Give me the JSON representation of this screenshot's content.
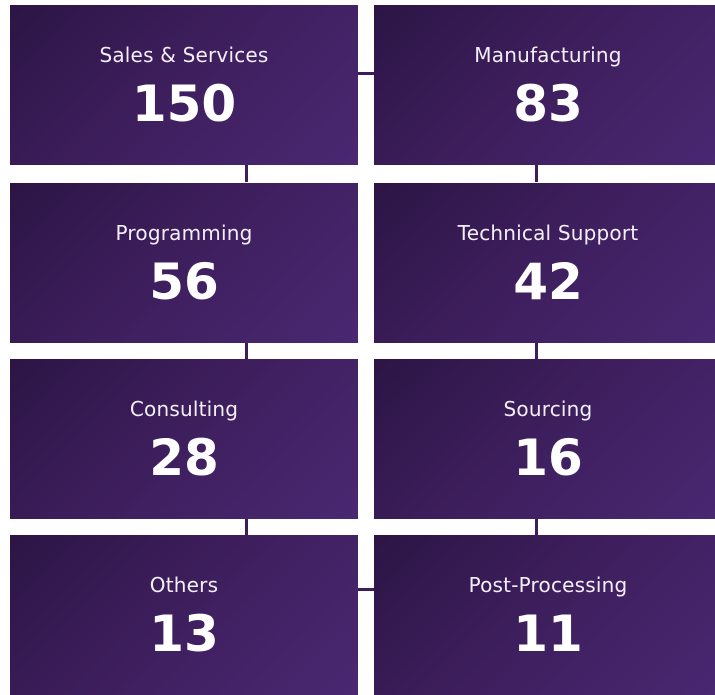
{
  "tiles": [
    {
      "label": "Sales & Services",
      "value": "150"
    },
    {
      "label": "Manufacturing",
      "value": "83"
    },
    {
      "label": "Programming",
      "value": "56"
    },
    {
      "label": "Technical Support",
      "value": "42"
    },
    {
      "label": "Consulting",
      "value": "28"
    },
    {
      "label": "Sourcing",
      "value": "16"
    },
    {
      "label": "Others",
      "value": "13"
    },
    {
      "label": "Post-Processing",
      "value": "11"
    }
  ],
  "colors": {
    "tile_dark": "#2c1545",
    "tile_light": "#4a2872",
    "text": "#ffffff"
  }
}
